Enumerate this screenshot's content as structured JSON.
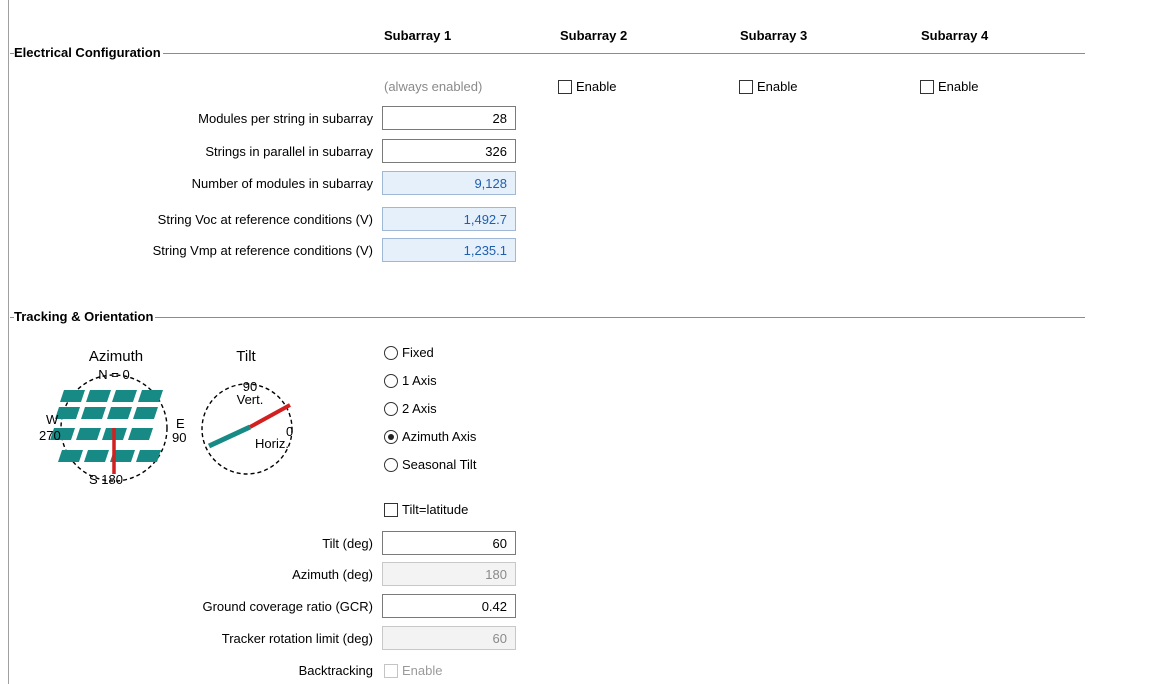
{
  "columns": [
    "Subarray 1",
    "Subarray 2",
    "Subarray 3",
    "Subarray 4"
  ],
  "electrical": {
    "title": "Electrical Configuration",
    "always_enabled": "(always enabled)",
    "enable_label": "Enable",
    "rows": [
      {
        "label": "Modules per string in subarray",
        "value": "28"
      },
      {
        "label": "Strings in parallel in subarray",
        "value": "326"
      },
      {
        "label": "Number of modules in subarray",
        "value": "9,128"
      },
      {
        "label": "String Voc at reference conditions (V)",
        "value": "1,492.7"
      },
      {
        "label": "String Vmp at reference conditions (V)",
        "value": "1,235.1"
      }
    ]
  },
  "tracking": {
    "title": "Tracking & Orientation",
    "diagram": {
      "azimuth_title": "Azimuth",
      "tilt_title": "Tilt",
      "n_label": "N = 0",
      "w_label": "W",
      "w_deg": "270",
      "e_label": "E",
      "e_deg": "90",
      "s_label": "S 180",
      "vert_deg": "90",
      "vert_label": "Vert.",
      "horiz_deg": "0",
      "horiz_label": "Horiz."
    },
    "modes": [
      "Fixed",
      "1 Axis",
      "2 Axis",
      "Azimuth Axis",
      "Seasonal Tilt"
    ],
    "selected_mode": "Azimuth Axis",
    "tilt_latitude_label": "Tilt=latitude",
    "rows": [
      {
        "label": "Tilt (deg)",
        "value": "60"
      },
      {
        "label": "Azimuth (deg)",
        "value": "180"
      },
      {
        "label": "Ground coverage ratio (GCR)",
        "value": "0.42"
      },
      {
        "label": "Tracker rotation limit (deg)",
        "value": "60"
      }
    ],
    "backtracking_label": "Backtracking",
    "backtracking_enable": "Enable"
  },
  "colors": {
    "calc_bg": "#e6f0fb",
    "calc_text": "#1f5fb0",
    "panel_teal": "#178a86",
    "indicator_red": "#d21f1f"
  }
}
